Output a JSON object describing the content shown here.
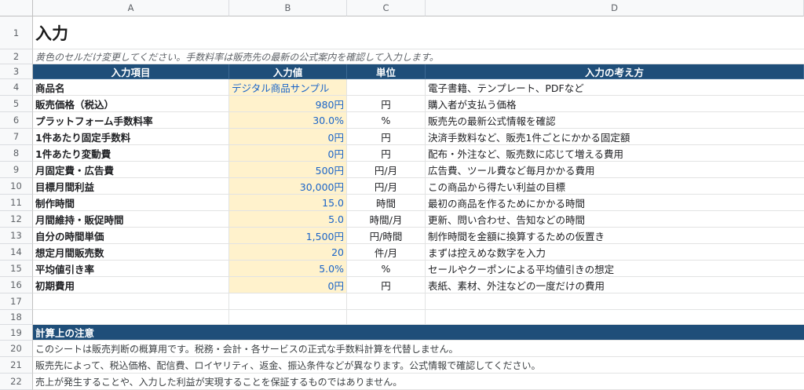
{
  "columns": [
    "A",
    "B",
    "C",
    "D"
  ],
  "title": "入力",
  "note": "黄色のセルだけ変更してください。手数料率は販売先の最新の公式案内を確認して入力します。",
  "table_headers": [
    "入力項目",
    "入力値",
    "単位",
    "入力の考え方"
  ],
  "rows": [
    {
      "num": "4",
      "label": "商品名",
      "value": "デジタル商品サンプル",
      "unit": "",
      "desc": "電子書籍、テンプレート、PDFなど"
    },
    {
      "num": "5",
      "label": "販売価格（税込）",
      "value": "980円",
      "unit": "円",
      "desc": "購入者が支払う価格"
    },
    {
      "num": "6",
      "label": "プラットフォーム手数料率",
      "value": "30.0%",
      "unit": "%",
      "desc": "販売先の最新公式情報を確認"
    },
    {
      "num": "7",
      "label": "1件あたり固定手数料",
      "value": "0円",
      "unit": "円",
      "desc": "決済手数料など、販売1件ごとにかかる固定額"
    },
    {
      "num": "8",
      "label": "1件あたり変動費",
      "value": "0円",
      "unit": "円",
      "desc": "配布・外注など、販売数に応じて増える費用"
    },
    {
      "num": "9",
      "label": "月固定費・広告費",
      "value": "500円",
      "unit": "円/月",
      "desc": "広告費、ツール費など毎月かかる費用"
    },
    {
      "num": "10",
      "label": "目標月間利益",
      "value": "30,000円",
      "unit": "円/月",
      "desc": "この商品から得たい利益の目標"
    },
    {
      "num": "11",
      "label": "制作時間",
      "value": "15.0",
      "unit": "時間",
      "desc": "最初の商品を作るためにかかる時間"
    },
    {
      "num": "12",
      "label": "月間維持・販促時間",
      "value": "5.0",
      "unit": "時間/月",
      "desc": "更新、問い合わせ、告知などの時間"
    },
    {
      "num": "13",
      "label": "自分の時間単価",
      "value": "1,500円",
      "unit": "円/時間",
      "desc": "制作時間を金額に換算するための仮置き"
    },
    {
      "num": "14",
      "label": "想定月間販売数",
      "value": "20",
      "unit": "件/月",
      "desc": "まずは控えめな数字を入力"
    },
    {
      "num": "15",
      "label": "平均値引き率",
      "value": "5.0%",
      "unit": "%",
      "desc": "セールやクーポンによる平均値引きの想定"
    },
    {
      "num": "16",
      "label": "初期費用",
      "value": "0円",
      "unit": "円",
      "desc": "表紙、素材、外注などの一度だけの費用"
    }
  ],
  "blank_rows": [
    "17",
    "18"
  ],
  "section": {
    "num": "19",
    "title": "計算上の注意"
  },
  "footnotes": [
    {
      "num": "20",
      "text": "このシートは販売判断の概算用です。税務・会計・各サービスの正式な手数料計算を代替しません。"
    },
    {
      "num": "21",
      "text": "販売先によって、税込価格、配信費、ロイヤリティ、返金、振込条件などが異なります。公式情報で確認してください。"
    },
    {
      "num": "22",
      "text": "売上が発生することや、入力した利益が実現することを保証するものではありません。"
    }
  ],
  "row_nums": {
    "r1": "1",
    "r2": "2",
    "r3": "3"
  }
}
